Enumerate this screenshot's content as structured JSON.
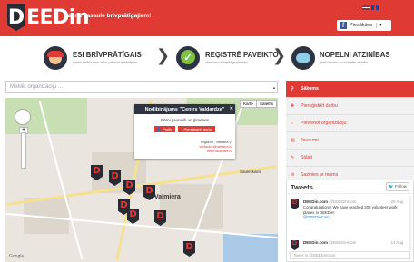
{
  "header": {
    "logo_letter": "D",
    "logo_text": "EEDin",
    "tagline": "Jauna pasaule brīvprātīgajiem!",
    "fb_label": "Piesākties",
    "fb_caret": "▾",
    "accent": "#e03a35"
  },
  "steps": [
    {
      "title": "ESI BRĪVPRĀTĪGAIS",
      "subtitle": "padari labāku savu dzīvi, palīdzot apkārtējiem",
      "icon": "volunteer-icon"
    },
    {
      "title": "REĢISTRĒ PAVEIKTO",
      "subtitle": "vieta savu brīvprātīgo pieredzi",
      "icon": "checkmark-icon"
    },
    {
      "title": "NOPELNI ATZINĪBAS",
      "subtitle": "gūsti virtuālu un novērtētu atzinību",
      "icon": "chat-bubble-icon"
    }
  ],
  "search": {
    "placeholder": "Meklēt organizāciju ..."
  },
  "map": {
    "type_buttons": [
      "Karte",
      "Satelīts"
    ],
    "labels": [
      "Valmiera",
      "Sauleskalni"
    ],
    "popup": {
      "title": "Nodibinājums \"Centrs Valdardze\"",
      "close": "✕",
      "subtitle": "Bērni, jaunieši un ģimenes",
      "btn_profile": "Profils",
      "btn_register": "Piereģistrēt darbu",
      "address": "Rīgas iel., Valmiera",
      "email": "valdardze@valmiera.lv",
      "web": "www.valdardze.lv"
    },
    "footer": "Google"
  },
  "sidebar": {
    "items": [
      {
        "label": "Sākums",
        "icon": "home-icon",
        "active": true
      },
      {
        "label": "Piereģistrēt darbu",
        "icon": "plus-icon"
      },
      {
        "label": "Pievienot organizāciju",
        "icon": "home-icon"
      },
      {
        "label": "Jaunumi",
        "icon": "news-icon"
      },
      {
        "label": "Stāsti",
        "icon": "pen-icon"
      },
      {
        "label": "Sazinies ar mums",
        "icon": "mail-icon"
      }
    ]
  },
  "tweets": {
    "title": "Tweets",
    "follow": "Follow",
    "items": [
      {
        "name": "DEEDin.com",
        "handle": "@DEEDinCom",
        "date": "20 Aug",
        "text": "Congratulations! We have reached 200 volunteer work places in DEEDin!",
        "mention": "@DEEDinCom"
      },
      {
        "name": "DEEDin.com",
        "handle": "@DEEDinCom",
        "date": "14 Aug",
        "text": "",
        "mention": ""
      }
    ],
    "compose_placeholder": "Tweet to @DEEDinCom"
  }
}
